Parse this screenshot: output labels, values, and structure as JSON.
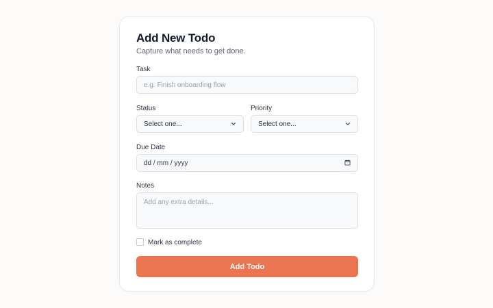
{
  "form": {
    "title": "Add New Todo",
    "subtitle": "Capture what needs to get done.",
    "task": {
      "label": "Task",
      "placeholder": "e.g. Finish onboarding flow",
      "value": ""
    },
    "status": {
      "label": "Status",
      "selected": "Select one..."
    },
    "priority": {
      "label": "Priority",
      "selected": "Select one..."
    },
    "due_date": {
      "label": "Due Date",
      "placeholder": "dd / mm / yyyy",
      "icon": "calendar-icon"
    },
    "notes": {
      "label": "Notes",
      "placeholder": "Add any extra details...",
      "value": ""
    },
    "complete": {
      "label": "Mark as complete",
      "checked": false
    },
    "submit_label": "Add Todo"
  },
  "colors": {
    "background": "#fcfbf9",
    "card": "#ffffff",
    "accent": "#ea7550",
    "field_bg": "#f8f9fb",
    "field_border": "#dcdfe5"
  }
}
